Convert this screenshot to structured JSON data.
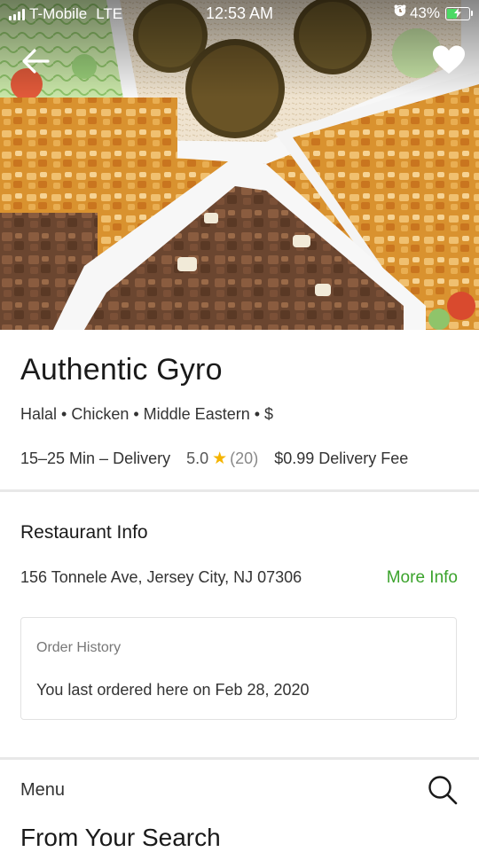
{
  "status_bar": {
    "carrier": "T-Mobile",
    "network": "LTE",
    "time": "12:53 AM",
    "battery": "43%",
    "battery_level": 0.43,
    "icons": [
      "signal-bars-icon",
      "screen-rotation-lock-icon",
      "location-arrow-icon",
      "alarm-clock-icon",
      "battery-charging-icon"
    ]
  },
  "header": {
    "back_icon": "arrow-left-icon",
    "favorite_icon": "heart-icon"
  },
  "restaurant": {
    "name": "Authentic Gyro",
    "tags": "Halal • Chicken • Middle Eastern • $",
    "delivery_time": "15–25 Min – Delivery",
    "rating": "5.0",
    "rating_count": "(20)",
    "delivery_fee": "$0.99 Delivery Fee"
  },
  "info": {
    "section_title": "Restaurant Info",
    "address": "156 Tonnele Ave, Jersey City, NJ 07306",
    "more_info": "More Info"
  },
  "order_history": {
    "label": "Order History",
    "text": "You last ordered here on Feb 28, 2020"
  },
  "menu": {
    "label": "Menu",
    "search_icon": "search-icon",
    "section_title": "From Your Search"
  },
  "colors": {
    "accent_green": "#3ba32c",
    "star_yellow": "#f5b400",
    "divider": "#e8e8e8"
  }
}
